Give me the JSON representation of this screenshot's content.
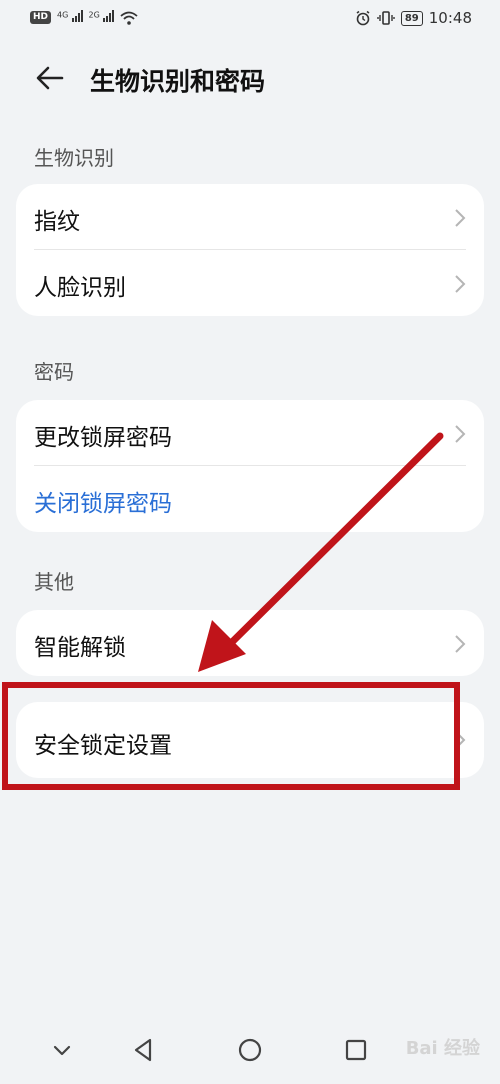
{
  "status_bar": {
    "hd": "HD",
    "net1": "4G",
    "net2": "2G",
    "battery": "89",
    "time": "10:48"
  },
  "header": {
    "title": "生物识别和密码"
  },
  "sections": {
    "biometrics": {
      "label": "生物识别",
      "items": [
        "指纹",
        "人脸识别"
      ]
    },
    "password": {
      "label": "密码",
      "items": [
        "更改锁屏密码",
        "关闭锁屏密码"
      ]
    },
    "other": {
      "label": "其他",
      "items": [
        "智能解锁",
        "安全锁定设置"
      ]
    }
  },
  "colors": {
    "accent": "#2a6fd6",
    "annotation": "#c0141a"
  },
  "watermark": "Bai 经验"
}
